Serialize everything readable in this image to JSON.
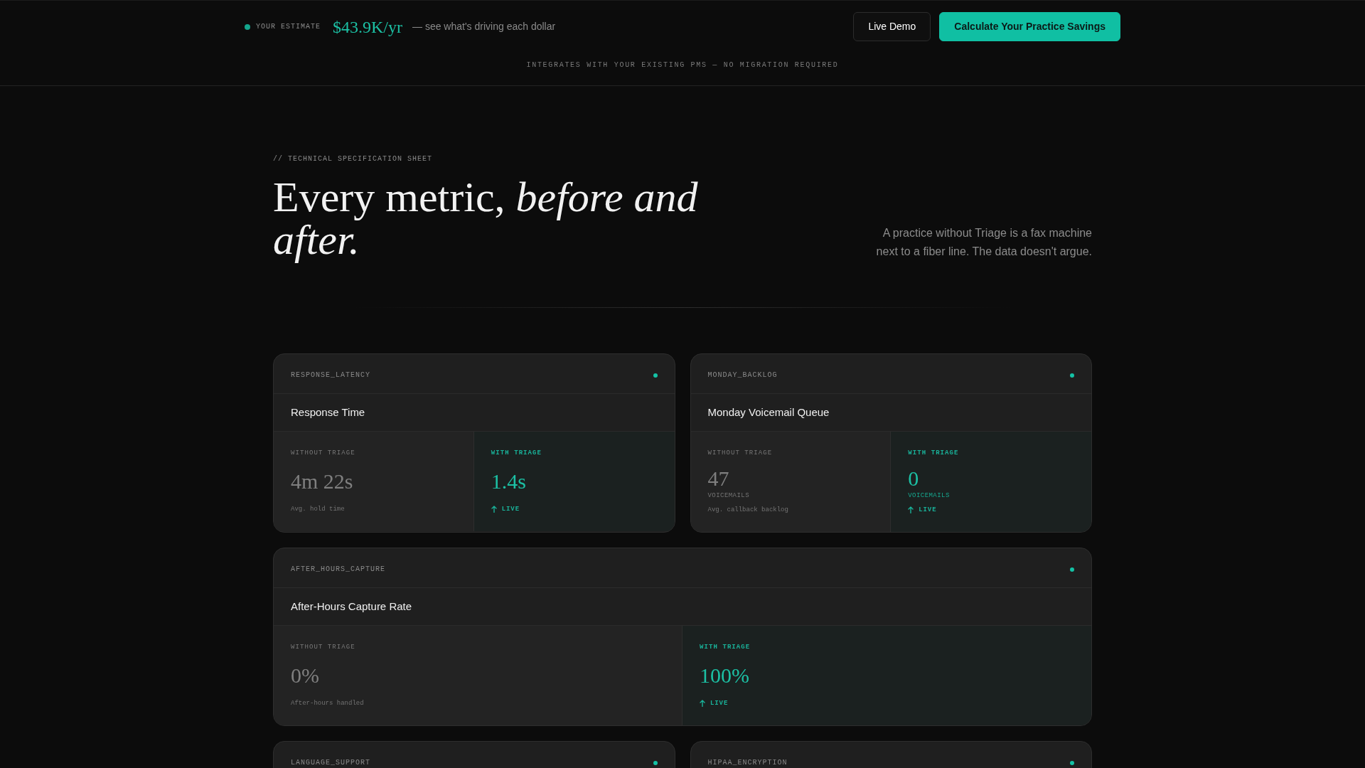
{
  "top_bar": {
    "estimate_label": "YOUR ESTIMATE",
    "estimate_value": "$43.9K/yr",
    "estimate_note": "— see what's driving each dollar",
    "buttons": [
      {
        "label": "Live Demo",
        "kind": "outline"
      },
      {
        "label": "Calculate Your Practice Savings",
        "kind": "primary"
      }
    ],
    "integrations_note": "INTEGRATES WITH YOUR EXISTING PMS — NO MIGRATION REQUIRED"
  },
  "hero": {
    "eyebrow": "// TECHNICAL SPECIFICATION SHEET",
    "heading": "Every metric, *before and after.*",
    "tagline": "A practice without Triage is a fax machine next to a fiber line. The data doesn't argue."
  },
  "metrics": [
    {
      "kind": "half",
      "code": "RESPONSE_LATENCY",
      "title": "Response Time",
      "without_triage": {
        "label": "WITHOUT TRIAGE",
        "value": "4m 22s",
        "note": "Avg. hold time"
      },
      "with_triage": {
        "label": "WITH TRIAGE",
        "value": "1.4s",
        "status": "LIVE"
      }
    },
    {
      "kind": "half",
      "code": "MONDAY_BACKLOG",
      "title": "Monday Voicemail Queue",
      "without_triage": {
        "label": "WITHOUT TRIAGE",
        "value": "47",
        "unit": "VOICEMAILS",
        "note": "Avg. callback backlog"
      },
      "with_triage": {
        "label": "WITH TRIAGE",
        "value": "0",
        "unit": "VOICEMAILS",
        "status": "LIVE"
      }
    },
    {
      "kind": "full",
      "code": "AFTER_HOURS_CAPTURE",
      "title": "After-Hours Capture Rate",
      "without_triage": {
        "label": "WITHOUT TRIAGE",
        "value": "0%",
        "note": "After-hours handled"
      },
      "with_triage": {
        "label": "WITH TRIAGE",
        "value": "100%",
        "status": "LIVE"
      }
    },
    {
      "kind": "half",
      "code": "LANGUAGE_SUPPORT"
    },
    {
      "kind": "half",
      "code": "HIPAA_ENCRYPTION"
    }
  ]
}
